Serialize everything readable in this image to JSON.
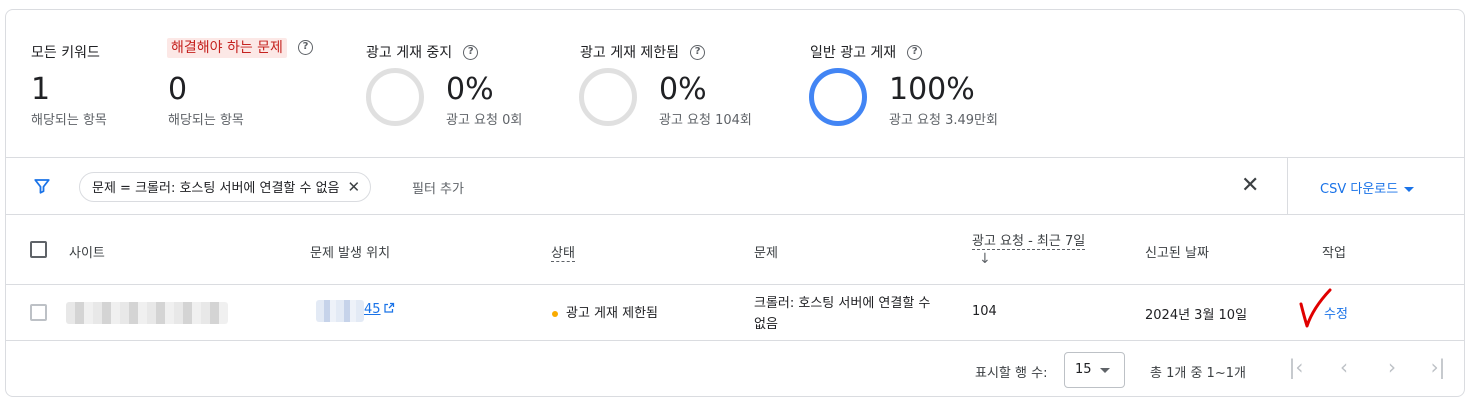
{
  "summary": {
    "all_keywords": {
      "title": "모든 키워드",
      "value": "1",
      "sub": "해당되는 항목"
    },
    "issues_to_fix": {
      "title": "해결해야 하는 문제",
      "value": "0",
      "sub": "해당되는 항목"
    },
    "ad_serving_stopped": {
      "title": "광고 게재 중지",
      "value": "0%",
      "sub": "광고 요청 0회",
      "percent": 0
    },
    "ad_serving_limited": {
      "title": "광고 게재 제한됨",
      "value": "0%",
      "sub": "광고 요청 104회",
      "percent": 0
    },
    "ad_serving_normal": {
      "title": "일반 광고 게재",
      "value": "100%",
      "sub": "광고 요청 3.49만회",
      "percent": 100
    },
    "help_glyph": "?"
  },
  "filter": {
    "chip_label": "문제 = 크롤러: 호스팅 서버에 연결할 수 없음",
    "chip_close": "✕",
    "add_filter": "필터 추가",
    "clear": "✕",
    "csv_download": "CSV 다운로드"
  },
  "table": {
    "headers": {
      "site": "사이트",
      "location": "문제 발생 위치",
      "status": "상태",
      "issue": "문제",
      "ad_requests": "광고 요청 - 최근 7일",
      "reported_date": "신고된 날짜",
      "action": "작업"
    },
    "sort_arrow": "↓",
    "rows": [
      {
        "location_suffix": "45",
        "status": "광고 게재 제한됨",
        "issue": "크롤러: 호스팅 서버에 연결할 수 없음",
        "ad_requests": "104",
        "reported_date": "2024년 3월 10일",
        "action": "수정"
      }
    ]
  },
  "pagination": {
    "rows_label": "표시할 행 수:",
    "rows_value": "15",
    "range": "총 1개 중 1~1개",
    "first": "|‹",
    "prev": "‹",
    "next": "›",
    "last": "›|"
  },
  "colors": {
    "accent": "#1a73e8",
    "ring_full": "#4285f4",
    "ring_empty": "#e0e0e0",
    "warning_dot": "#f9ab00",
    "issue_highlight_bg": "#fce8e6",
    "issue_highlight_text": "#c5221f",
    "annotation_mark": "#e00000"
  },
  "icons": {
    "filter": "filter-icon",
    "external_link": "open-in-new-icon",
    "help": "help-circle-icon"
  }
}
